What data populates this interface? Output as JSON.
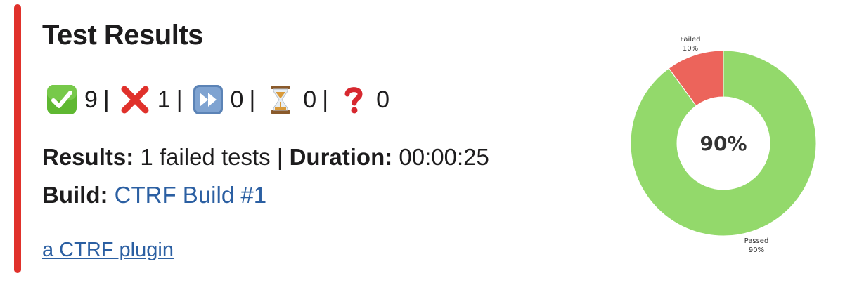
{
  "colors": {
    "bar": "#e0312b",
    "link": "#2b5fa2",
    "passed": "#93d96b",
    "failed": "#ec645b"
  },
  "header": {
    "title": "Test Results"
  },
  "summary": {
    "passed": {
      "icon": "check-mark-icon",
      "count": "9"
    },
    "sep1": "|",
    "failed": {
      "icon": "cross-mark-icon",
      "count": "1"
    },
    "sep2": "|",
    "skipped": {
      "icon": "fast-forward-icon",
      "count": "0"
    },
    "sep3": "|",
    "pending": {
      "icon": "hourglass-icon",
      "count": "0"
    },
    "sep4": "|",
    "other": {
      "icon": "question-mark-icon",
      "count": "0"
    }
  },
  "details": {
    "results_label": "Results:",
    "results_value": "1 failed tests",
    "divider": "|",
    "duration_label": "Duration:",
    "duration_value": "00:00:25",
    "build_label": "Build:",
    "build_link": "CTRF Build #1"
  },
  "footer": {
    "plugin_link": "a CTRF plugin"
  },
  "chart_data": {
    "type": "pie",
    "style": "donut",
    "center_label": "90%",
    "slices": [
      {
        "label": "Passed",
        "percent_label": "90%",
        "value": 90
      },
      {
        "label": "Failed",
        "percent_label": "10%",
        "value": 10
      }
    ]
  }
}
